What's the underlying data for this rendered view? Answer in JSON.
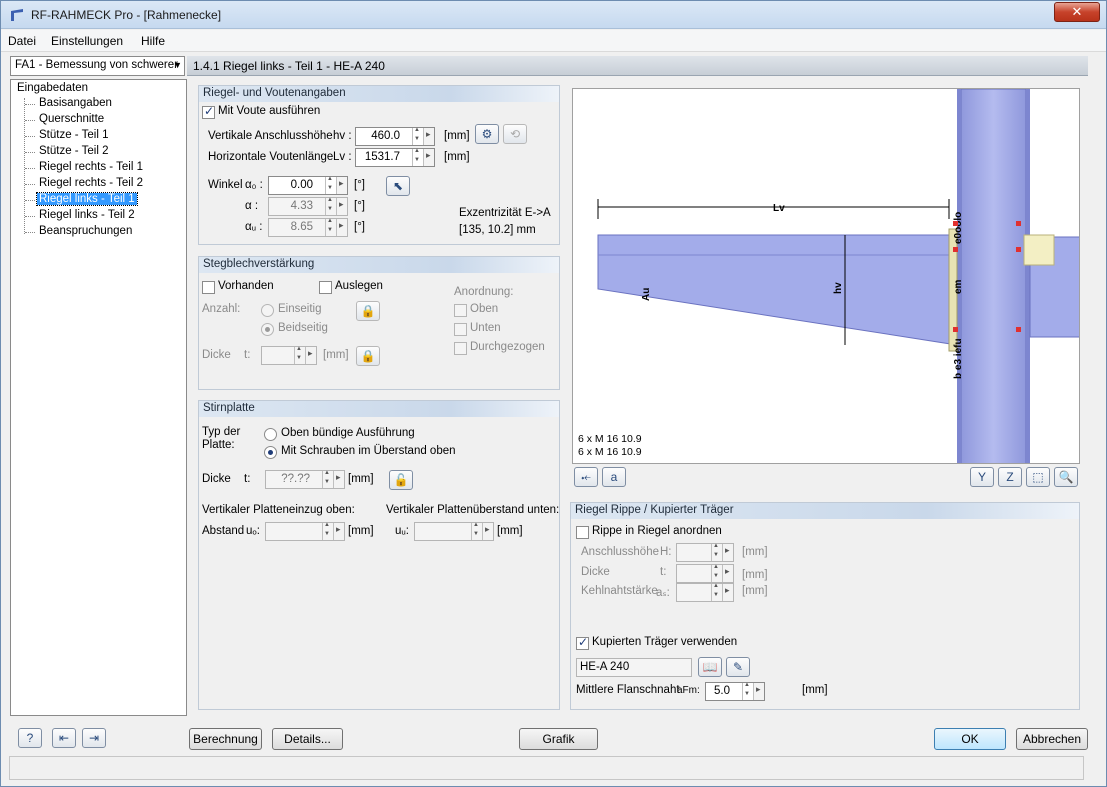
{
  "window": {
    "title": "RF-RAHMECK Pro - [Rahmenecke]",
    "close_label": "✕"
  },
  "menu": {
    "datei": "Datei",
    "einstellungen": "Einstellungen",
    "hilfe": "Hilfe"
  },
  "nav_select": {
    "value": "FA1 - Bemessung von schwerer"
  },
  "tree": {
    "root": "Eingabedaten",
    "items": [
      "Basisangaben",
      "Querschnitte",
      "Stütze - Teil 1",
      "Stütze - Teil 2",
      "Riegel rechts - Teil 1",
      "Riegel rechts - Teil 2",
      "Riegel links - Teil 1",
      "Riegel links - Teil 2",
      "Beanspruchungen"
    ]
  },
  "page_title": "1.4.1 Riegel links - Teil 1 - HE-A 240",
  "riegel": {
    "title": "Riegel- und Voutenangaben",
    "mit_voute": "Mit Voute ausführen",
    "vert_label": "Vertikale Anschlusshöhe",
    "vert_sym": "hv :",
    "vert_value": "460.0",
    "vert_unit": "[mm]",
    "hor_label": "Horizontale Voutenlänge",
    "hor_sym": "Lv :",
    "hor_value": "1531.7",
    "hor_unit": "[mm]",
    "winkel_label": "Winkel",
    "a0_sym": "α₀ :",
    "a0_value": "0.00",
    "a0_unit": "[°]",
    "a_sym": "α :",
    "a_value": "4.33",
    "a_unit": "[°]",
    "au_sym": "αᵤ :",
    "au_value": "8.65",
    "au_unit": "[°]",
    "exz_label": "Exzentrizität E->A",
    "exz_value": "[135, 10.2] mm"
  },
  "steg": {
    "title": "Stegblechverstärkung",
    "vorhanden": "Vorhanden",
    "auslegen": "Auslegen",
    "anzahl": "Anzahl:",
    "einseitig": "Einseitig",
    "beidseitig": "Beidseitig",
    "dicke": "Dicke",
    "t": "t:",
    "unit": "[mm]",
    "anordnung": "Anordnung:",
    "oben": "Oben",
    "unten": "Unten",
    "durchgezogen": "Durchgezogen"
  },
  "stirn": {
    "title": "Stirnplatte",
    "typ_label_1": "Typ der",
    "typ_label_2": "Platte:",
    "opt1": "Oben bündige Ausführung",
    "opt2": "Mit Schrauben im Überstand oben",
    "dicke": "Dicke",
    "t": "t:",
    "t_value": "??.??",
    "unit": "[mm]",
    "einzug_label": "Vertikaler Platteneinzug oben:",
    "ueberstand_label": "Vertikaler Plattenüberstand unten:",
    "abstand": "Abstand",
    "uo_sym": "uₒ:",
    "uu_sym": "uᵤ:"
  },
  "graphic": {
    "lv": "Lv",
    "hv": "hv",
    "au": "Au",
    "em": "em",
    "e0oolo": "e0oolo",
    "e3ufu": "b e3 iefu",
    "bolt1": "6 x M 16 10.9",
    "bolt2": "6 x M 16 10.9"
  },
  "rippe": {
    "title": "Riegel Rippe / Kupierter Träger",
    "rippe_cb": "Rippe in Riegel anordnen",
    "anschluss": "Anschlusshöhe",
    "anschluss_sym": "H:",
    "dicke": "Dicke",
    "dicke_sym": "t:",
    "kehl": "Kehlnahtstärke",
    "kehl_sym": "aₛ:",
    "unit": "[mm]",
    "kupiert_cb": "Kupierten Träger verwenden",
    "profil": "HE-A 240",
    "flansch_label": "Mittlere Flanschnaht",
    "flansch_sym": "aFm:",
    "flansch_value": "5.0",
    "flansch_unit": "[mm]"
  },
  "buttons": {
    "berechnung": "Berechnung",
    "details": "Details...",
    "grafik": "Grafik",
    "ok": "OK",
    "abbrechen": "Abbrechen"
  },
  "colors": {
    "beam": "#9fa8e6",
    "beam_dark": "#7d86d0",
    "header_bg": "#c9d8ea"
  }
}
